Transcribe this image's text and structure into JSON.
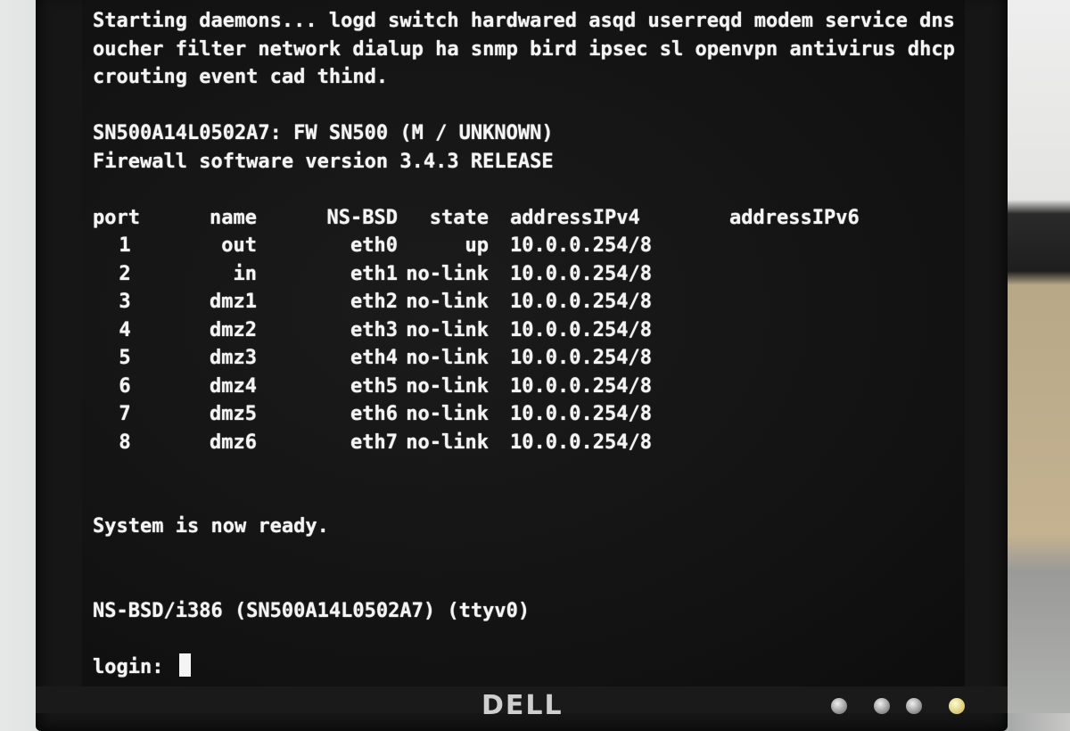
{
  "boot": {
    "daemons_line1": "Starting daemons... logd switch hardwared asqd userreqd modem service dns ldap",
    "daemons_line2": "oucher filter network dialup ha snmp bird ipsec sl openvpn antivirus dhcp ntp s",
    "daemons_line3": "crouting event cad thind.",
    "device_line": "SN500A14L0502A7: FW SN500 (M / UNKNOWN)",
    "version_line": "Firewall software version 3.4.3 RELEASE"
  },
  "ports_table": {
    "headers": [
      "port",
      "name",
      "NS-BSD",
      "state",
      "addressIPv4",
      "addressIPv6"
    ],
    "rows": [
      [
        "1",
        "out",
        "eth0",
        "up",
        "10.0.0.254/8",
        ""
      ],
      [
        "2",
        "in",
        "eth1",
        "no-link",
        "10.0.0.254/8",
        ""
      ],
      [
        "3",
        "dmz1",
        "eth2",
        "no-link",
        "10.0.0.254/8",
        ""
      ],
      [
        "4",
        "dmz2",
        "eth3",
        "no-link",
        "10.0.0.254/8",
        ""
      ],
      [
        "5",
        "dmz3",
        "eth4",
        "no-link",
        "10.0.0.254/8",
        ""
      ],
      [
        "6",
        "dmz4",
        "eth5",
        "no-link",
        "10.0.0.254/8",
        ""
      ],
      [
        "7",
        "dmz5",
        "eth6",
        "no-link",
        "10.0.0.254/8",
        ""
      ],
      [
        "8",
        "dmz6",
        "eth7",
        "no-link",
        "10.0.0.254/8",
        ""
      ]
    ]
  },
  "status": {
    "ready": "System is now ready.",
    "banner": "NS-BSD/i386 (SN500A14L0502A7) (ttyv0)",
    "login_prompt": "login:",
    "login_value": ""
  },
  "monitor": {
    "brand": "DELL"
  },
  "icons": {
    "cursor": "block-cursor-icon",
    "buttons": [
      "monitor-button-icon",
      "monitor-button-icon",
      "monitor-button-icon",
      "power-led-icon"
    ]
  },
  "colors": {
    "terminal_text": "#f4f4f4",
    "terminal_bg": "#121212",
    "bezel": "#161616"
  }
}
